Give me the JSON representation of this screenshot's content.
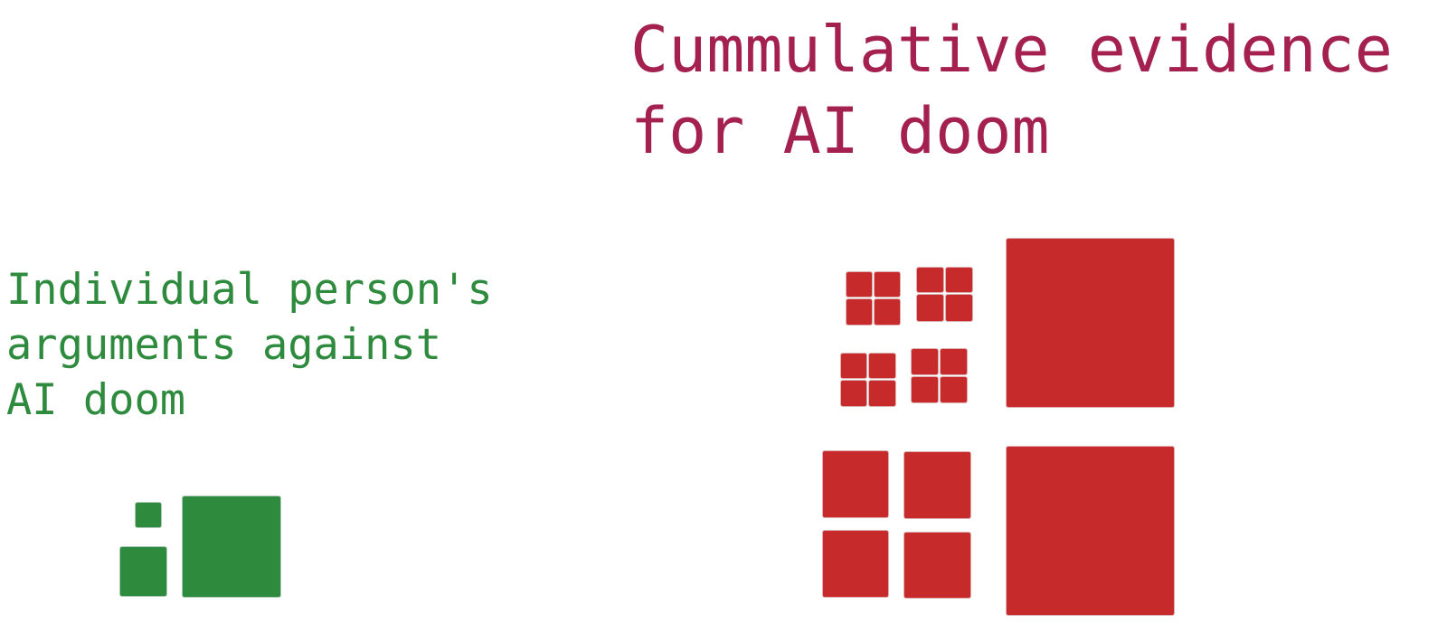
{
  "colors": {
    "red_title": "#a3204f",
    "green_title": "#2e8b3e",
    "red_block": "#c62a2a",
    "green_block": "#2e8a3d",
    "background": "#ffffff"
  },
  "cumulative": {
    "title_lines": [
      "Cummulative evidence",
      "for AI doom"
    ]
  },
  "individual": {
    "title_lines": [
      "Individual person's",
      "arguments against",
      "AI doom"
    ]
  }
}
